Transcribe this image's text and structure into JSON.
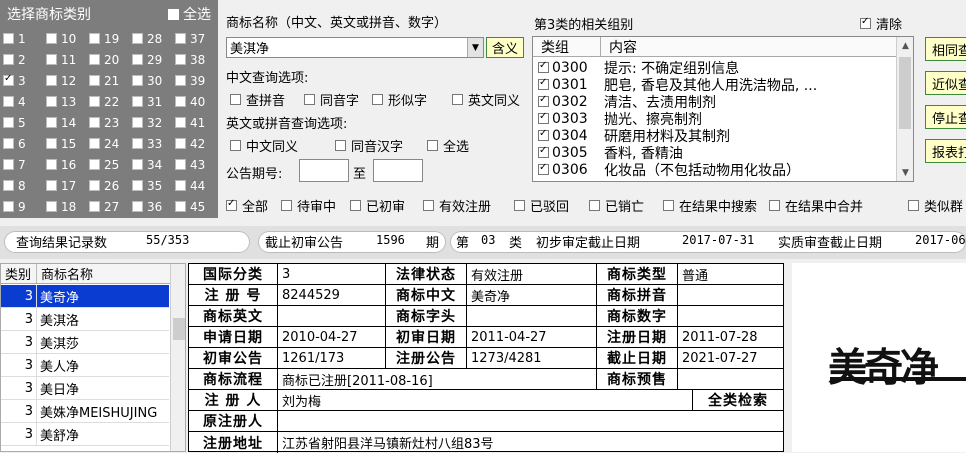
{
  "category_panel": {
    "title": "选择商标类别",
    "select_all": "全选",
    "select_all_checked": false,
    "categories": [
      {
        "num": "1",
        "checked": false
      },
      {
        "num": "10",
        "checked": false
      },
      {
        "num": "19",
        "checked": false
      },
      {
        "num": "28",
        "checked": false
      },
      {
        "num": "37",
        "checked": false
      },
      {
        "num": "2",
        "checked": false
      },
      {
        "num": "11",
        "checked": false
      },
      {
        "num": "20",
        "checked": false
      },
      {
        "num": "29",
        "checked": false
      },
      {
        "num": "38",
        "checked": false
      },
      {
        "num": "3",
        "checked": true
      },
      {
        "num": "12",
        "checked": false
      },
      {
        "num": "21",
        "checked": false
      },
      {
        "num": "30",
        "checked": false
      },
      {
        "num": "39",
        "checked": false
      },
      {
        "num": "4",
        "checked": false
      },
      {
        "num": "13",
        "checked": false
      },
      {
        "num": "22",
        "checked": false
      },
      {
        "num": "31",
        "checked": false
      },
      {
        "num": "40",
        "checked": false
      },
      {
        "num": "5",
        "checked": false
      },
      {
        "num": "14",
        "checked": false
      },
      {
        "num": "23",
        "checked": false
      },
      {
        "num": "32",
        "checked": false
      },
      {
        "num": "41",
        "checked": false
      },
      {
        "num": "6",
        "checked": false
      },
      {
        "num": "15",
        "checked": false
      },
      {
        "num": "24",
        "checked": false
      },
      {
        "num": "33",
        "checked": false
      },
      {
        "num": "42",
        "checked": false
      },
      {
        "num": "7",
        "checked": false
      },
      {
        "num": "16",
        "checked": false
      },
      {
        "num": "25",
        "checked": false
      },
      {
        "num": "34",
        "checked": false
      },
      {
        "num": "43",
        "checked": false
      },
      {
        "num": "8",
        "checked": false
      },
      {
        "num": "17",
        "checked": false
      },
      {
        "num": "26",
        "checked": false
      },
      {
        "num": "35",
        "checked": false
      },
      {
        "num": "44",
        "checked": false
      },
      {
        "num": "9",
        "checked": false
      },
      {
        "num": "18",
        "checked": false
      },
      {
        "num": "27",
        "checked": false
      },
      {
        "num": "36",
        "checked": false
      },
      {
        "num": "45",
        "checked": false
      }
    ]
  },
  "query": {
    "name_label": "商标名称（中文、英文或拼音、数字）",
    "name_value": "美淇净",
    "meaning_button": "含义",
    "cn_options_label": "中文查询选项:",
    "cn_options": [
      {
        "label": "查拼音",
        "checked": false
      },
      {
        "label": "同音字",
        "checked": false
      },
      {
        "label": "形似字",
        "checked": false
      },
      {
        "label": "英文同义",
        "checked": false
      }
    ],
    "en_options_label": "英文或拼音查询选项:",
    "en_options": [
      {
        "label": "中文同义",
        "checked": false
      },
      {
        "label": "同音汉字",
        "checked": false
      },
      {
        "label": "全选",
        "checked": false
      }
    ],
    "date_label": "公告期号:",
    "date_to": "至",
    "date_from_value": "",
    "date_to_value": ""
  },
  "groups": {
    "title": "第3类的相关组别",
    "clear_label": "清除",
    "clear_checked": true,
    "col_group": "类组",
    "col_content": "内容",
    "rows": [
      {
        "code": "0300",
        "content": "提示: 不确定组别信息",
        "checked": true
      },
      {
        "code": "0301",
        "content": "肥皂, 香皂及其他人用洗洁物品, ...",
        "checked": true
      },
      {
        "code": "0302",
        "content": "清洁、去渍用制剂",
        "checked": true
      },
      {
        "code": "0303",
        "content": "抛光、擦亮制剂",
        "checked": true
      },
      {
        "code": "0304",
        "content": "研磨用材料及其制剂",
        "checked": true
      },
      {
        "code": "0305",
        "content": "香料, 香精油",
        "checked": true
      },
      {
        "code": "0306",
        "content": "化妆品（不包括动物用化妆品）",
        "checked": true
      }
    ]
  },
  "side_buttons": [
    "相同查",
    "近似查",
    "停止查",
    "报表打"
  ],
  "filters": [
    {
      "label": "全部",
      "checked": true
    },
    {
      "label": "待审中",
      "checked": false
    },
    {
      "label": "已初审",
      "checked": false
    },
    {
      "label": "有效注册",
      "checked": false
    },
    {
      "label": "已驳回",
      "checked": false
    },
    {
      "label": "已销亡",
      "checked": false
    },
    {
      "label": "在结果中搜索",
      "checked": false
    },
    {
      "label": "在结果中合并",
      "checked": false
    },
    {
      "label": "类似群",
      "checked": false
    }
  ],
  "status": {
    "records_label": "查询结果记录数",
    "records_value": "55/353",
    "cutoff_label": "截止初审公告",
    "cutoff_value": "1596",
    "cutoff_unit": "期",
    "class_prefix": "第",
    "class_value": "03",
    "class_suffix": "类",
    "prelim_label": "初步审定截止日期",
    "prelim_value": "2017-07-31",
    "exam_label": "实质审查截止日期",
    "exam_value": "2017-06-"
  },
  "results": {
    "col_class": "类别",
    "col_name": "商标名称",
    "rows": [
      {
        "cls": "3",
        "name": "美奇净",
        "selected": true
      },
      {
        "cls": "3",
        "name": "美淇洛",
        "selected": false
      },
      {
        "cls": "3",
        "name": "美淇莎",
        "selected": false
      },
      {
        "cls": "3",
        "name": "美人净",
        "selected": false
      },
      {
        "cls": "3",
        "name": "美日净",
        "selected": false
      },
      {
        "cls": "3",
        "name": "美姝净MEISHUJING",
        "selected": false
      },
      {
        "cls": "3",
        "name": "美舒净",
        "selected": false
      }
    ]
  },
  "detail": {
    "intl_class_label": "国际分类",
    "intl_class": "3",
    "legal_status_label": "法律状态",
    "legal_status": "有效注册",
    "type_label": "商标类型",
    "type": "普通",
    "reg_no_label": "注 册 号",
    "reg_no": "8244529",
    "cn_name_label": "商标中文",
    "cn_name": "美奇净",
    "pinyin_label": "商标拼音",
    "pinyin": "",
    "en_name_label": "商标英文",
    "en_name": "",
    "head_label": "商标字头",
    "head": "",
    "digits_label": "商标数字",
    "digits": "",
    "apply_date_label": "申请日期",
    "apply_date": "2010-04-27",
    "prelim_date_label": "初审日期",
    "prelim_date": "2011-04-27",
    "reg_date_label": "注册日期",
    "reg_date": "2011-07-28",
    "prelim_pub_label": "初审公告",
    "prelim_pub": "1261/173",
    "reg_pub_label": "注册公告",
    "reg_pub": "1273/4281",
    "expiry_label": "截止日期",
    "expiry": "2021-07-27",
    "flow_label": "商标流程",
    "flow": "商标已注册[2011-08-16]",
    "warning_label": "商标预售",
    "warning": "",
    "registrant_label": "注 册 人",
    "registrant": "刘为梅",
    "all_class_search": "全类检索",
    "orig_registrant_label": "原注册人",
    "orig_registrant": "",
    "address_label": "注册地址",
    "address": "江苏省射阳县洋马镇新灶村八组83号"
  },
  "preview": {
    "logo_text": "美奇净"
  }
}
